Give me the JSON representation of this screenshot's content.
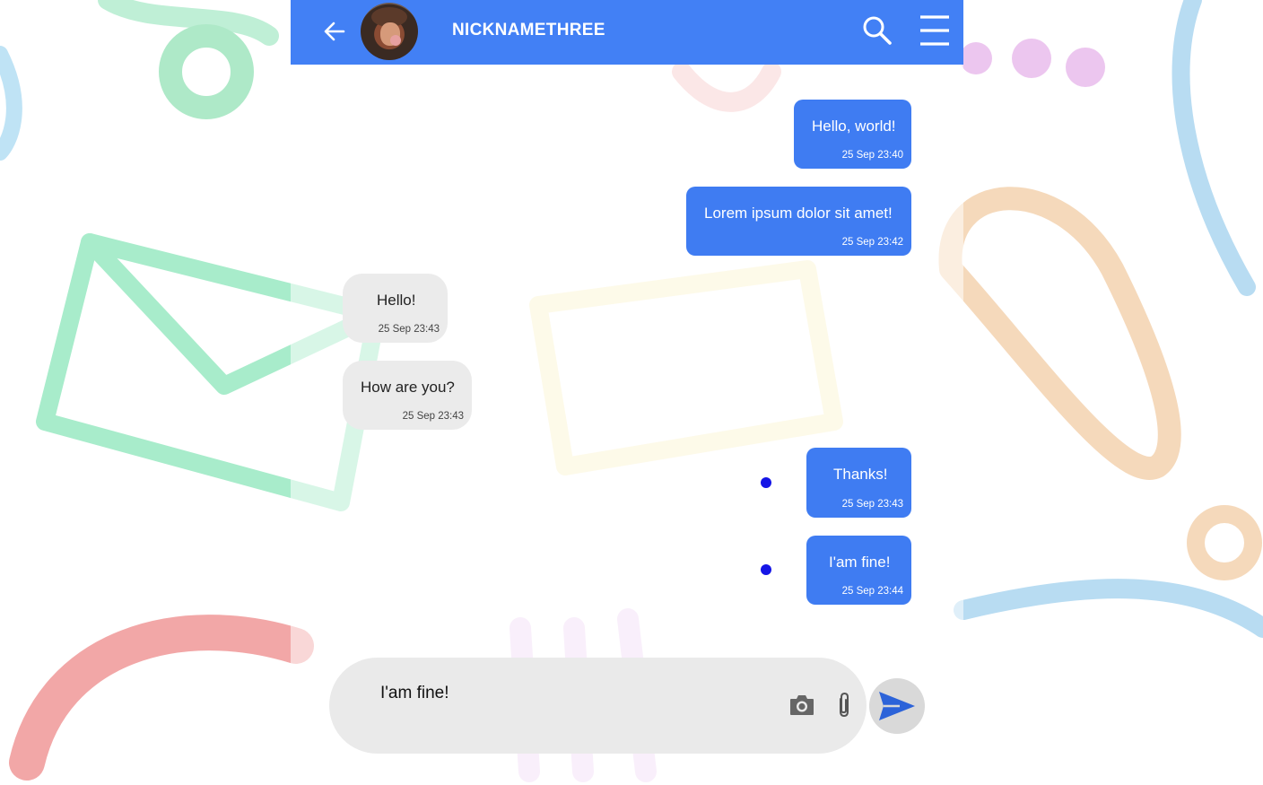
{
  "header": {
    "contact_name": "NICKNAMETHREE",
    "back_icon": "arrow-left-icon",
    "search_icon": "search-icon",
    "menu_icon": "hamburger-menu-icon"
  },
  "messages": [
    {
      "direction": "outgoing",
      "text": "Hello, world!",
      "time": "25 Sep 23:40"
    },
    {
      "direction": "outgoing",
      "text": "Lorem ipsum dolor sit amet!",
      "time": "25 Sep 23:42"
    },
    {
      "direction": "incoming",
      "text": "Hello!",
      "time": "25 Sep 23:43"
    },
    {
      "direction": "incoming",
      "text": "How are you?",
      "time": "25 Sep 23:43"
    },
    {
      "direction": "outgoing",
      "text": "Thanks!",
      "time": "25 Sep 23:43"
    },
    {
      "direction": "outgoing",
      "text": "I'am fine!",
      "time": "25 Sep 23:44"
    }
  ],
  "composer": {
    "value": "I'am fine!",
    "camera_icon": "camera-icon",
    "attach_icon": "paperclip-icon",
    "send_icon": "send-icon"
  },
  "colors": {
    "header": "#4280f5",
    "outgoing_bubble": "#3f7cf2",
    "incoming_bubble": "#ebebeb",
    "unread_dot": "#1515e6"
  }
}
